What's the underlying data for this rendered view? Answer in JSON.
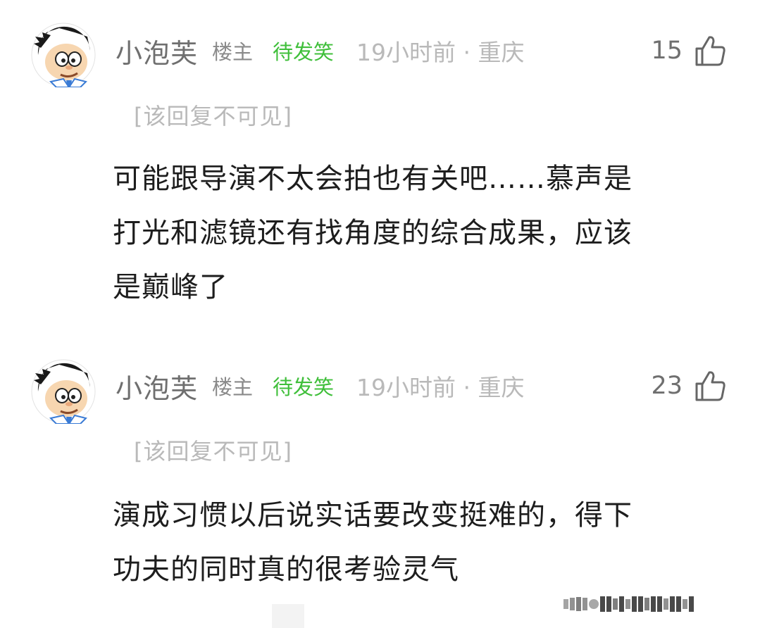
{
  "comments": [
    {
      "username": "小泡芙",
      "role": "楼主",
      "medal": "待发笑",
      "time": "19小时前 · 重庆",
      "likes": "15",
      "hidden_reply": "[该回复不可见]",
      "lines": [
        "可能跟导演不太会拍也有关吧……慕声是",
        "打光和滤镜还有找角度的综合成果，应该",
        "是巅峰了"
      ]
    },
    {
      "username": "小泡芙",
      "role": "楼主",
      "medal": "待发笑",
      "time": "19小时前 · 重庆",
      "likes": "23",
      "hidden_reply": "[该回复不可见]",
      "lines": [
        "演成习惯以后说实话要改变挺难的，得下",
        "功夫的同时真的很考验灵气"
      ]
    }
  ],
  "colors": {
    "medal": "#3fbf3a",
    "meta_gray": "#b9b9b9",
    "username_gray": "#6f6f6f"
  },
  "icons": {
    "avatar": "cartoon-boy-avatar",
    "like": "thumbs-up-icon"
  }
}
